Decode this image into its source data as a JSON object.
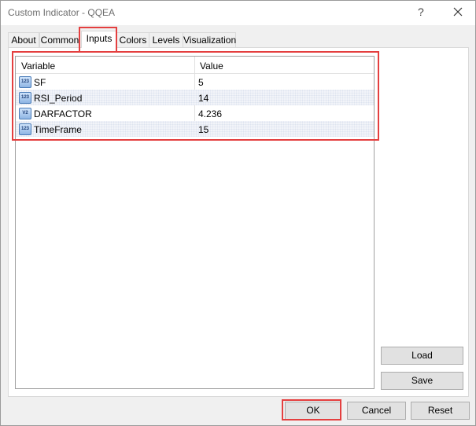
{
  "window": {
    "title": "Custom Indicator - QQEA",
    "help_glyph": "?",
    "close_glyph": "✕"
  },
  "tabs": [
    {
      "label": "About"
    },
    {
      "label": "Common"
    },
    {
      "label": "Inputs"
    },
    {
      "label": "Colors"
    },
    {
      "label": "Levels"
    },
    {
      "label": "Visualization"
    }
  ],
  "active_tab": "Inputs",
  "grid": {
    "columns": [
      "Variable",
      "Value"
    ],
    "rows": [
      {
        "icon": "integer-icon",
        "icon_text": "123",
        "name": "SF",
        "value": "5"
      },
      {
        "icon": "integer-icon",
        "icon_text": "123",
        "name": "RSI_Period",
        "value": "14"
      },
      {
        "icon": "double-icon",
        "icon_text": "V2",
        "name": "DARFACTOR",
        "value": "4.236"
      },
      {
        "icon": "integer-icon",
        "icon_text": "123",
        "name": "TimeFrame",
        "value": "15"
      }
    ]
  },
  "side_buttons": {
    "load": "Load",
    "save": "Save"
  },
  "footer_buttons": {
    "ok": "OK",
    "cancel": "Cancel",
    "reset": "Reset"
  },
  "colors": {
    "highlight": "#e43f3f",
    "alt_row": "#f2f4f9"
  }
}
